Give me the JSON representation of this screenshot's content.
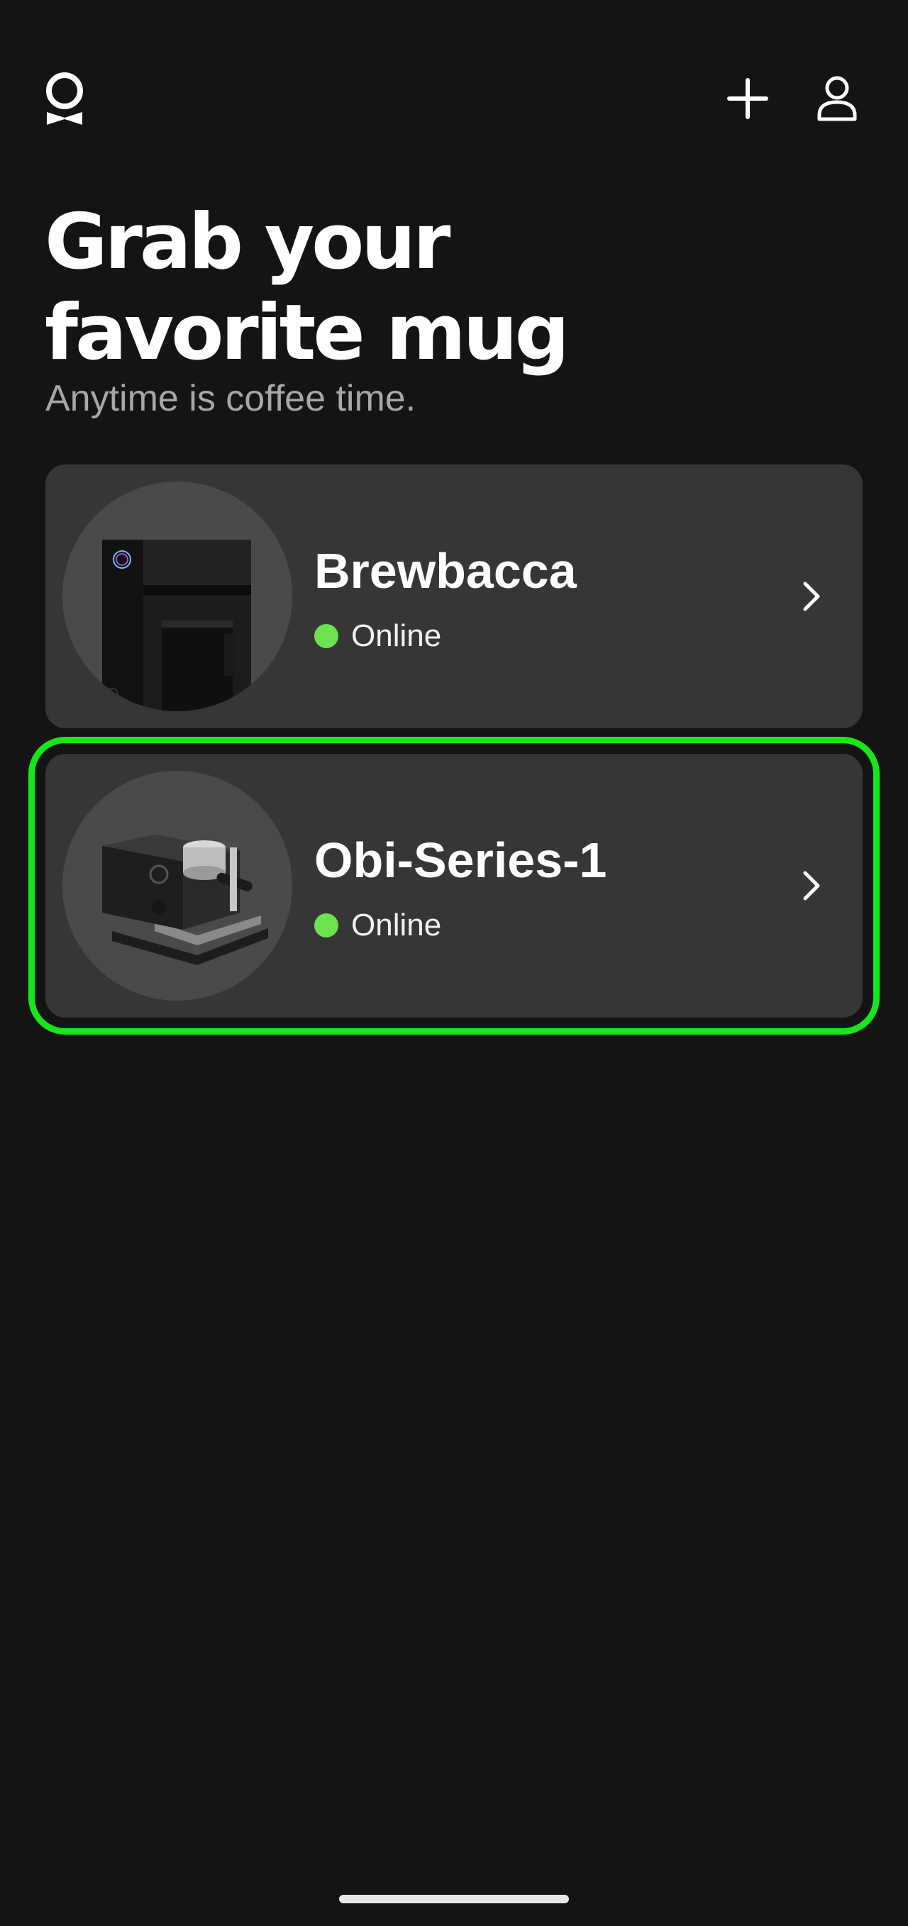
{
  "header": {
    "logo_icon": "ohm-logo-icon",
    "add_icon": "plus-icon",
    "profile_icon": "person-icon"
  },
  "hero": {
    "title_line1": "Grab your",
    "title_line2": "favorite mug",
    "subtitle": "Anytime is coffee time."
  },
  "devices": [
    {
      "name": "Brewbacca",
      "status": "Online",
      "status_color": "#6be34f",
      "image_icon": "drip-coffee-machine-icon",
      "selected": false
    },
    {
      "name": "Obi-Series-1",
      "status": "Online",
      "status_color": "#6be34f",
      "image_icon": "espresso-machine-icon",
      "selected": true
    }
  ],
  "colors": {
    "background": "#141414",
    "card": "#363636",
    "selection_outline": "#19e619",
    "subtitle": "#a7a7a7"
  }
}
